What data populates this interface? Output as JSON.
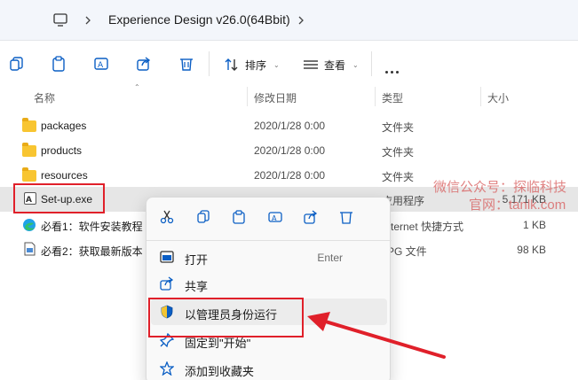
{
  "address": {
    "monitor_icon": "monitor-icon",
    "path": "Experience Design v26.0(64Bbit)"
  },
  "toolbar": {
    "sort_label": "排序",
    "view_label": "查看"
  },
  "columns": {
    "name": "名称",
    "date": "修改日期",
    "type": "类型",
    "size": "大小"
  },
  "rows": [
    {
      "name": "packages",
      "date": "2020/1/28 0:00",
      "type": "文件夹",
      "size": "",
      "icon": "folder-icon"
    },
    {
      "name": "products",
      "date": "2020/1/28 0:00",
      "type": "文件夹",
      "size": "",
      "icon": "folder-icon"
    },
    {
      "name": "resources",
      "date": "2020/1/28 0:00",
      "type": "文件夹",
      "size": "",
      "icon": "folder-icon"
    },
    {
      "name": "Set-up.exe",
      "date": "",
      "type": "应用程序",
      "size": "5,171 KB",
      "icon": "adobe-app-icon"
    },
    {
      "name": "必看1：软件安装教程",
      "date": "",
      "type": "Internet 快捷方式",
      "size": "1 KB",
      "icon": "edge-shortcut-icon"
    },
    {
      "name": "必看2：获取最新版本",
      "date": "",
      "type": "JPG 文件",
      "size": "98 KB",
      "icon": "image-file-icon"
    }
  ],
  "watermark": {
    "line1": "微信公众号：探临科技",
    "line2": "官网：tanlk.com"
  },
  "context_menu": {
    "items": [
      {
        "label": "打开",
        "key": "Enter",
        "icon": "open-icon"
      },
      {
        "label": "共享",
        "key": "",
        "icon": "share-icon"
      },
      {
        "label": "以管理员身份运行",
        "key": "",
        "icon": "shield-icon"
      },
      {
        "label": "固定到\"开始\"",
        "key": "",
        "icon": "pin-icon"
      },
      {
        "label": "添加到收藏夹",
        "key": "",
        "icon": "star-icon"
      }
    ]
  },
  "colors": {
    "highlight_red": "#e0202a",
    "accent_blue": "#0a5ec4"
  }
}
